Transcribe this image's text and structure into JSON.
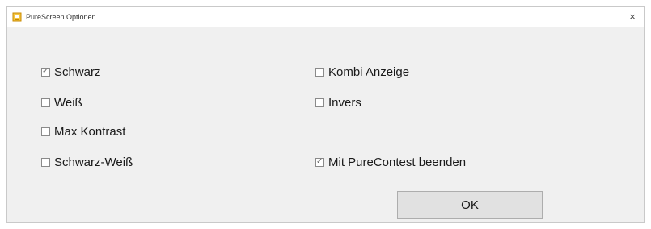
{
  "window": {
    "title": "PureScreen Optionen",
    "close_glyph": "×",
    "icon": "app-icon"
  },
  "options": {
    "schwarz": {
      "label": "Schwarz",
      "checked": true
    },
    "weiss": {
      "label": "Weiß",
      "checked": false
    },
    "max_kontrast": {
      "label": "Max Kontrast",
      "checked": false
    },
    "schwarz_weiss": {
      "label": "Schwarz-Weiß",
      "checked": false
    },
    "kombi_anzeige": {
      "label": "Kombi Anzeige",
      "checked": false
    },
    "invers": {
      "label": "Invers",
      "checked": false
    },
    "mit_purecontest_beenden": {
      "label": "Mit PureContest beenden",
      "checked": true
    }
  },
  "buttons": {
    "ok_label": "OK"
  },
  "check_glyph": "✓",
  "colors": {
    "window_bg": "#f0f0f0",
    "titlebar_bg": "#ffffff",
    "button_bg": "#e1e1e1"
  }
}
